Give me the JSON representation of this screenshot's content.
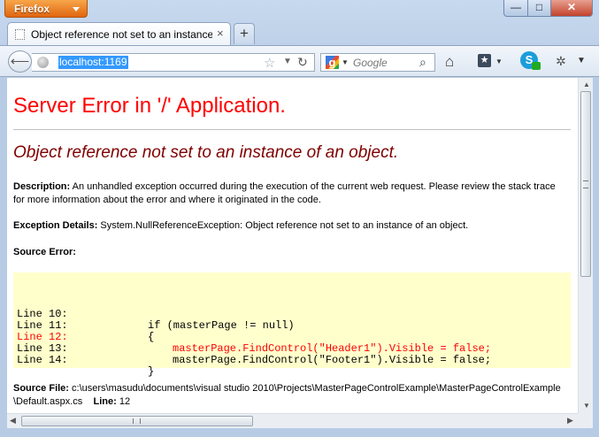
{
  "browser": {
    "menu_button": "Firefox",
    "window_controls": {
      "minimize": "—",
      "maximize": "□",
      "close": "✕"
    },
    "tab": {
      "title": "Object reference not set to an instance o...",
      "close": "×"
    },
    "new_tab": "+",
    "url": "localhost:1169",
    "search": {
      "placeholder": "Google"
    }
  },
  "page": {
    "heading": "Server Error in '/' Application.",
    "error_title": "Object reference not set to an instance of an object.",
    "description_label": "Description:",
    "description_text": " An unhandled exception occurred during the execution of the current web request. Please review the stack trace for more information about the error and where it originated in the code.",
    "exception_label": "Exception Details:",
    "exception_text": " System.NullReferenceException: Object reference not set to an instance of an object.",
    "source_error_label": "Source Error:",
    "code_lines": [
      {
        "num": "Line 10:",
        "code": "if (masterPage != null)",
        "indent": 0,
        "error": false
      },
      {
        "num": "Line 11:",
        "code": "{",
        "indent": 0,
        "error": false
      },
      {
        "num": "Line 12:",
        "code": "masterPage.FindControl(\"Header1\").Visible = false;",
        "indent": 1,
        "error": true
      },
      {
        "num": "Line 13:",
        "code": "masterPage.FindControl(\"Footer1\").Visible = false;",
        "indent": 1,
        "error": false
      },
      {
        "num": "Line 14:",
        "code": "}",
        "indent": 0,
        "error": false
      }
    ],
    "source_file_label": "Source File:",
    "source_file_path": " c:\\users\\masudu\\documents\\visual studio 2010\\Projects\\MasterPageControlExample\\MasterPageControlExample\\Default.aspx.cs",
    "line_label": "Line:",
    "line_value": " 12"
  },
  "colors": {
    "heading": "#ff0000",
    "error_title": "#800000",
    "source_box_bg": "#ffffcc",
    "error_line": "#ff0000",
    "menu_button": "#e8761f"
  }
}
